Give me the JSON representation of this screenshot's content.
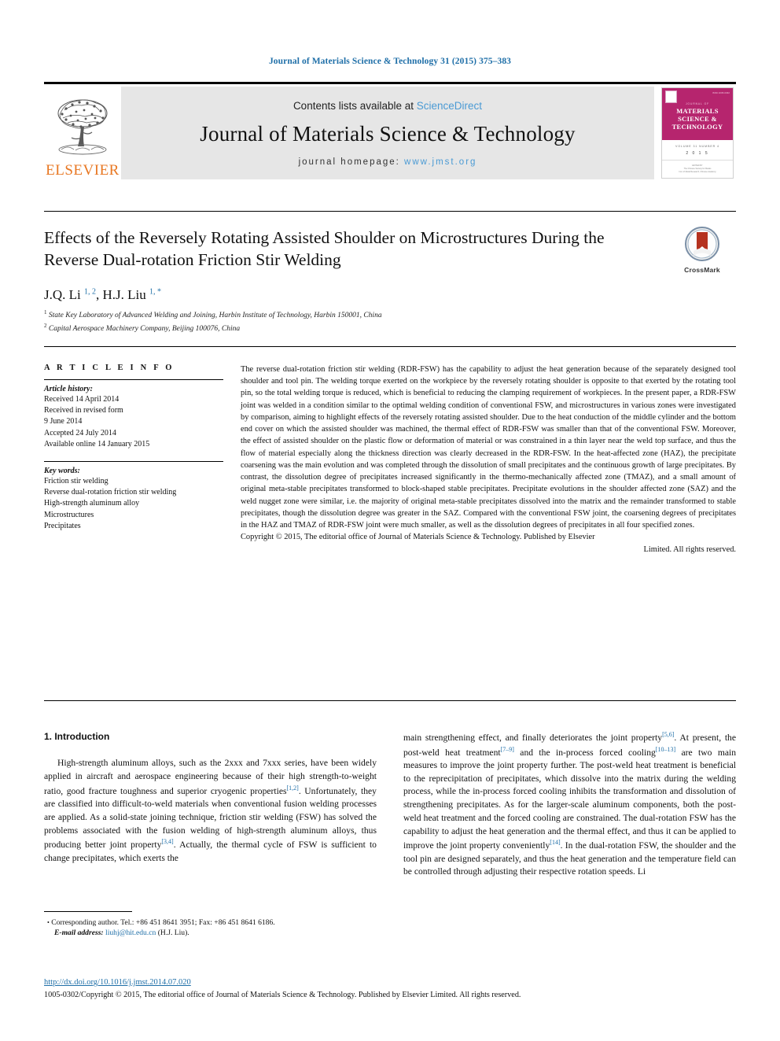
{
  "running_head": "Journal of Materials Science & Technology 31 (2015) 375–383",
  "masthead": {
    "contents_prefix": "Contents lists available at ",
    "contents_link": "ScienceDirect",
    "journal_title": "Journal of Materials Science & Technology",
    "homepage_prefix": "journal homepage: ",
    "homepage_url": "www.jmst.org",
    "publisher_name": "ELSEVIER",
    "cover": {
      "superline": "JOURNAL OF",
      "name_line1": "MATERIALS",
      "name_line2": "SCIENCE &",
      "name_line3": "TECHNOLOGY",
      "volume_line": "VOLUME 31   NUMBER 4",
      "year": "2 0 1 5",
      "footer_line1": "EDITED BY",
      "footer_line2": "The Chinese Society for Metals",
      "footer_line3": "Inst. of Metal Research, Chinese Academy",
      "footer_line4": "of Sciences and Journal Press",
      "corner_text": "ISSN 1005-0302"
    }
  },
  "article": {
    "title": "Effects of the Reversely Rotating Assisted Shoulder on Microstructures During the Reverse Dual-rotation Friction Stir Welding",
    "crossmark_label": "CrossMark",
    "authors": [
      {
        "name": "J.Q. Li",
        "sups": "1, 2"
      },
      {
        "name": "H.J. Liu",
        "sups": "1, *"
      }
    ],
    "authors_display": "J.Q. Li 1, 2, H.J. Liu 1, *",
    "affiliations": [
      {
        "marker": "1",
        "text": "State Key Laboratory of Advanced Welding and Joining, Harbin Institute of Technology, Harbin 150001, China"
      },
      {
        "marker": "2",
        "text": "Capital Aerospace Machinery Company, Beijing 100076, China"
      }
    ]
  },
  "article_info": {
    "heading": "A R T I C L E  I N F O",
    "history_label": "Article history:",
    "history": [
      "Received 14 April 2014",
      "Received in revised form",
      "9 June 2014",
      "Accepted 24 July 2014",
      "Available online 14 January 2015"
    ],
    "keywords_label": "Key words:",
    "keywords": [
      "Friction stir welding",
      "Reverse dual-rotation friction stir welding",
      "High-strength aluminum alloy",
      "Microstructures",
      "Precipitates"
    ]
  },
  "abstract": {
    "text": "The reverse dual-rotation friction stir welding (RDR-FSW) has the capability to adjust the heat generation because of the separately designed tool shoulder and tool pin. The welding torque exerted on the workpiece by the reversely rotating shoulder is opposite to that exerted by the rotating tool pin, so the total welding torque is reduced, which is beneficial to reducing the clamping requirement of workpieces. In the present paper, a RDR-FSW joint was welded in a condition similar to the optimal welding condition of conventional FSW, and microstructures in various zones were investigated by comparison, aiming to highlight effects of the reversely rotating assisted shoulder. Due to the heat conduction of the middle cylinder and the bottom end cover on which the assisted shoulder was machined, the thermal effect of RDR-FSW was smaller than that of the conventional FSW. Moreover, the effect of assisted shoulder on the plastic flow or deformation of material or was constrained in a thin layer near the weld top surface, and thus the flow of material especially along the thickness direction was clearly decreased in the RDR-FSW. In the heat-affected zone (HAZ), the precipitate coarsening was the main evolution and was completed through the dissolution of small precipitates and the continuous growth of large precipitates. By contrast, the dissolution degree of precipitates increased significantly in the thermo-mechanically affected zone (TMAZ), and a small amount of original meta-stable precipitates transformed to block-shaped stable precipitates. Precipitate evolutions in the shoulder affected zone (SAZ) and the weld nugget zone were similar, i.e. the majority of original meta-stable precipitates dissolved into the matrix and the remainder transformed to stable precipitates, though the dissolution degree was greater in the SAZ. Compared with the conventional FSW joint, the coarsening degrees of precipitates in the HAZ and TMAZ of RDR-FSW joint were much smaller, as well as the dissolution degrees of precipitates in all four specified zones.",
    "copyright_line1": "Copyright © 2015, The editorial office of Journal of Materials Science & Technology. Published by Elsevier",
    "copyright_line2": "Limited. All rights reserved."
  },
  "introduction": {
    "heading": "1. Introduction",
    "left_paragraph_part1": "High-strength aluminum alloys, such as the 2xxx and 7xxx series, have been widely applied in aircraft and aerospace engineering because of their high strength-to-weight ratio, good fracture toughness and superior cryogenic properties",
    "ref_1_2": "[1,2]",
    "left_paragraph_part2": ". Unfortunately, they are classified into difficult-to-weld materials when conventional fusion welding processes are applied. As a solid-state joining technique, friction stir welding (FSW) has solved the problems associated with the fusion welding of high-strength aluminum alloys, thus producing better joint property",
    "ref_3_4": "[3,4]",
    "left_paragraph_part3": ". Actually, the thermal cycle of FSW is sufficient to change precipitates, which exerts the",
    "right_part1": "main strengthening effect, and finally deteriorates the joint property",
    "ref_5_6": "[5,6]",
    "right_part2": ". At present, the post-weld heat treatment",
    "ref_7_9": "[7–9]",
    "right_part3": " and the in-process forced cooling",
    "ref_10_13": "[10–13]",
    "right_part4": " are two main measures to improve the joint property further. The post-weld heat treatment is beneficial to the reprecipitation of precipitates, which dissolve into the matrix during the welding process, while the in-process forced cooling inhibits the transformation and dissolution of strengthening precipitates. As for the larger-scale aluminum components, both the post-weld heat treatment and the forced cooling are constrained. The dual-rotation FSW has the capability to adjust the heat generation and the thermal effect, and thus it can be applied to improve the joint property conveniently",
    "ref_14": "[14]",
    "right_part5": ". In the dual-rotation FSW, the shoulder and the tool pin are designed separately, and thus the heat generation and the temperature field can be controlled through adjusting their respective rotation speeds. Li"
  },
  "footnote": {
    "bullet": "•",
    "corresponding": "Corresponding author. Tel.: +86 451 8641 3951; Fax: +86 451 8641 6186.",
    "email_label": "E-mail address:",
    "email": "liuhj@hit.edu.cn",
    "email_suffix": "(H.J. Liu)."
  },
  "footer": {
    "doi": "http://dx.doi.org/10.1016/j.jmst.2014.07.020",
    "copyright": "1005-0302/Copyright © 2015, The editorial office of Journal of Materials Science & Technology. Published by Elsevier Limited. All rights reserved."
  },
  "colors": {
    "link_blue": "#1f6fa8",
    "sciencedirect_blue": "#4a9ad4",
    "elsevier_orange": "#E87722",
    "cover_magenta": "#b6256e",
    "masthead_gray": "#e6e6e6"
  }
}
